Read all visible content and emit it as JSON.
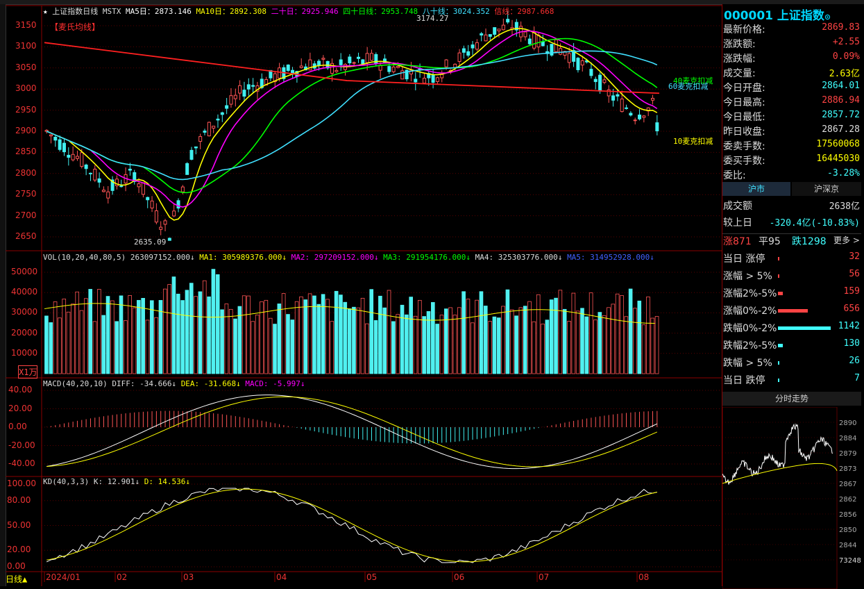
{
  "header": {
    "title": "上证指数日线",
    "ms": "MSTX",
    "ma5": "MA5日：2873.146",
    "ma10": "MA10日：2892.308",
    "ma20": "二十日：2925.946",
    "ma40": "四十日线：2953.748",
    "ma80": "八十线：3024.352",
    "ma_other": "信线：2987.668",
    "peak_label": "3174.27",
    "mcginley": "【麦氏均线】",
    "low_label": "2635.09",
    "deduct40": "40麦克扣减",
    "deduct60": "60麦克扣减",
    "deduct10": "10麦克扣减"
  },
  "price_axis": [
    "3150",
    "3100",
    "3050",
    "3000",
    "2950",
    "2900",
    "2850",
    "2800",
    "2750",
    "2700",
    "2650"
  ],
  "volume": {
    "title": "VOL(10,20,40,80,5)",
    "val": "263097152.000↓",
    "ma1": "MA1: 305989376.000↓",
    "ma2": "MA2: 297209152.000↓",
    "ma3": "MA3: 291954176.000↓",
    "ma4": "MA4: 325303776.000↓",
    "ma5": "MA5: 314952928.000↓",
    "axis": [
      "50000",
      "40000",
      "30000",
      "20000",
      "10000"
    ],
    "unit": "X1万"
  },
  "macd": {
    "title": "MACD(40,20,10)",
    "diff": "DIFF: -34.666↓",
    "dea": "DEA: -31.668↓",
    "macd": "MACD: -5.997↓",
    "axis": [
      "40.00",
      "20.00",
      "0.00",
      "-20.00",
      "-40.00"
    ]
  },
  "kd": {
    "title": "KD(40,3,3)",
    "k": "K: 12.901↓",
    "d": "D: 14.536↓",
    "axis": [
      "100.00",
      "80.00",
      "50.00",
      "20.00",
      "0.00"
    ]
  },
  "time_axis": {
    "period": "日线",
    "labels": [
      "2024/01",
      "02",
      "03",
      "04",
      "05",
      "06",
      "07",
      "08"
    ]
  },
  "side": {
    "code": "000001",
    "name": "上证指数",
    "rows": [
      {
        "label": "最新价格:",
        "value": "2869.83",
        "color": "#ff4444"
      },
      {
        "label": "涨跌额:",
        "value": "+2.55",
        "color": "#ff4444"
      },
      {
        "label": "涨跌幅:",
        "value": "0.09%",
        "color": "#ff4444"
      },
      {
        "label": "成交量:",
        "value": "2.63亿",
        "color": "#ffff00"
      },
      {
        "label": "今日开盘:",
        "value": "2864.01",
        "color": "#40ffff"
      },
      {
        "label": "今日最高:",
        "value": "2886.94",
        "color": "#ff4444"
      },
      {
        "label": "今日最低:",
        "value": "2857.72",
        "color": "#40ffff"
      },
      {
        "label": "昨日收盘:",
        "value": "2867.28",
        "color": "#dddddd"
      },
      {
        "label": "委卖手数:",
        "value": "17560068",
        "color": "#ffff00"
      },
      {
        "label": "委买手数:",
        "value": "16445030",
        "color": "#ffff00"
      },
      {
        "label": "委比:",
        "value": "-3.28%",
        "color": "#40ffff"
      }
    ],
    "tab_sh": "沪市",
    "tab_shsz": "沪深京",
    "turnover_label": "成交额",
    "turnover_value": "2638亿",
    "compare_label": "较上日",
    "compare_value": "-320.4亿(-10.83%)",
    "up": "涨871",
    "flat": "平95",
    "down": "跌1298",
    "more": "更多 >",
    "dist": [
      {
        "label": "当日 涨停",
        "value": "32",
        "frac": 0.0,
        "color": "#ff4444"
      },
      {
        "label": "涨幅 > 5%",
        "value": "56",
        "frac": 0.02,
        "color": "#ff4444"
      },
      {
        "label": "涨幅2%-5%",
        "value": "159",
        "frac": 0.09,
        "color": "#ff4444"
      },
      {
        "label": "涨幅0%-2%",
        "value": "656",
        "frac": 0.57,
        "color": "#ff4444"
      },
      {
        "label": "跌幅0%-2%",
        "value": "1142",
        "frac": 1.0,
        "color": "#40ffff"
      },
      {
        "label": "跌幅2%-5%",
        "value": "130",
        "frac": 0.09,
        "color": "#40ffff"
      },
      {
        "label": "跌幅 > 5%",
        "value": "26",
        "frac": 0.01,
        "color": "#40ffff"
      },
      {
        "label": "当日 跌停",
        "value": "7",
        "frac": 0.0,
        "color": "#40ffff"
      }
    ],
    "intraday_title": "分时走势",
    "intraday_axis": [
      "2890",
      "2884",
      "2879",
      "2873",
      "2867",
      "2862",
      "2856",
      "2850",
      "2844",
      "73248"
    ]
  },
  "colors": {
    "up": "#ff5555",
    "down": "#40f0f0",
    "ma5": "#ffffff",
    "ma10": "#ffff00",
    "ma20": "#ff00ff",
    "ma40": "#00ff00",
    "ma80": "#40e0ff",
    "ma_long": "#ff2020"
  }
}
